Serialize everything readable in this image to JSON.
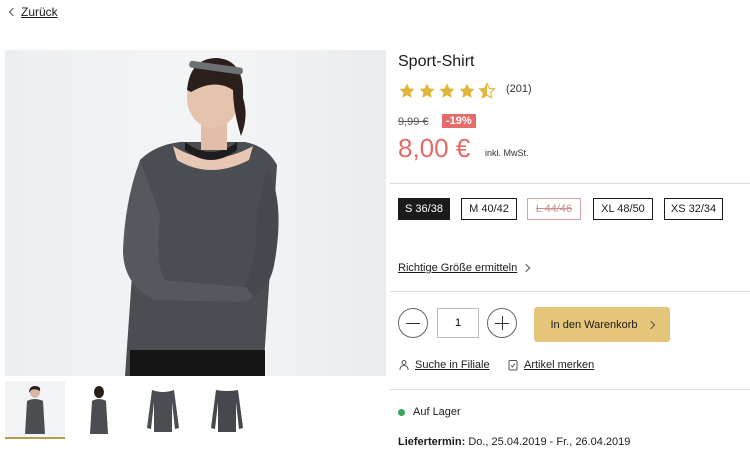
{
  "nav": {
    "back_label": "Zurück"
  },
  "product": {
    "title": "Sport-Shirt",
    "rating": 4.5,
    "rating_max": 5,
    "review_count": "(201)",
    "old_price": "9,99 €",
    "discount": "-19%",
    "price": "8,00 €",
    "vat_note": "inkl. MwSt.",
    "colors": {
      "price": "#e56a6a",
      "star": "#e2b53b",
      "cart_button": "#e4c57a",
      "in_stock": "#3aa55d"
    }
  },
  "sizes": [
    {
      "label": "S 36/38",
      "state": "selected"
    },
    {
      "label": "M 40/42",
      "state": "available"
    },
    {
      "label": "L 44/46",
      "state": "unavailable"
    },
    {
      "label": "XL 48/50",
      "state": "available"
    },
    {
      "label": "XS 32/34",
      "state": "available"
    }
  ],
  "size_guide_link": "Richtige Größe ermitteln",
  "cart": {
    "quantity": "1",
    "button_label": "In den Warenkorb"
  },
  "actions": {
    "store_search": "Suche in Filiale",
    "remember": "Artikel merken"
  },
  "availability": {
    "status": "Auf Lager"
  },
  "delivery": {
    "label": "Liefertermin:",
    "dates": "Do., 25.04.2019 - Fr., 26.04.2019"
  },
  "gallery": {
    "thumbnails": [
      "front-view",
      "back-view",
      "shirt-front",
      "shirt-back"
    ],
    "selected_index": 0
  }
}
